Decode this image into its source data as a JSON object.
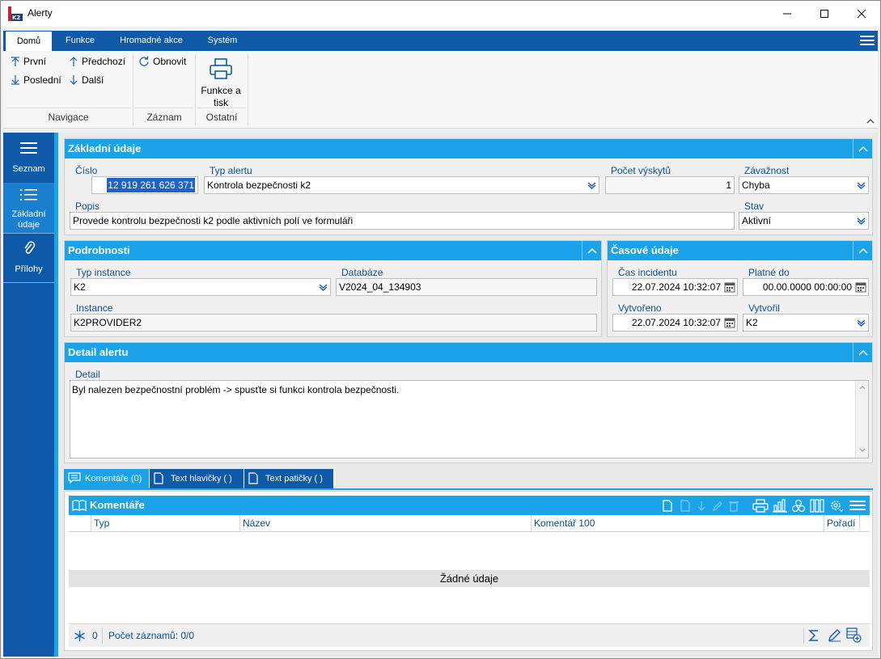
{
  "window": {
    "title": "Alerty",
    "app_icon": "k2-logo-icon",
    "controls": [
      "minimize-icon",
      "maximize-icon",
      "close-icon"
    ]
  },
  "ribbon": {
    "tabs": [
      {
        "label": "Domů",
        "active": true
      },
      {
        "label": "Funkce"
      },
      {
        "label": "Hromadné akce"
      },
      {
        "label": "Systém"
      }
    ],
    "groups": {
      "navigace": {
        "label": "Navigace",
        "first": "První",
        "previous": "Předchozí",
        "last": "Poslední",
        "next": "Další"
      },
      "zaznam": {
        "label": "Záznam",
        "refresh": "Obnovit"
      },
      "ostatni": {
        "label": "Ostatní",
        "print_line1": "Funkce a",
        "print_line2": "tisk"
      }
    }
  },
  "leftnav": {
    "items": [
      {
        "label": "Seznam",
        "icon": "menu-icon"
      },
      {
        "label_line1": "Základní",
        "label_line2": "údaje",
        "icon": "list-icon",
        "active": true
      },
      {
        "label": "Přílohy",
        "icon": "paperclip-icon"
      }
    ]
  },
  "zakladni": {
    "header": "Základní údaje",
    "cislo_label": "Číslo",
    "cislo": "12 919 261 626 371",
    "typ_label": "Typ alertu",
    "typ": "Kontrola bezpečnosti k2",
    "pocet_label": "Počet výskytů",
    "pocet": "1",
    "zavaznost_label": "Závažnost",
    "zavaznost": "Chyba",
    "popis_label": "Popis",
    "popis": "Provede kontrolu bezpečnosti k2 podle aktivních polí ve formuláři",
    "stav_label": "Stav",
    "stav": "Aktivní"
  },
  "podrobnosti": {
    "header": "Podrobnosti",
    "typ_instance_label": "Typ instance",
    "typ_instance": "K2",
    "databaze_label": "Databáze",
    "databaze": "V2024_04_134903",
    "instance_label": "Instance",
    "instance": "K2PROVIDER2"
  },
  "casove": {
    "header": "Časové údaje",
    "cas_label": "Čas incidentu",
    "cas": "22.07.2024 10:32:07",
    "platne_label": "Platné do",
    "platne": "00.00.0000 00:00:00",
    "vytvoreno_label": "Vytvořeno",
    "vytvoreno": "22.07.2024 10:32:07",
    "vytvoril_label": "Vytvořil",
    "vytvoril": "K2"
  },
  "detail": {
    "header": "Detail alertu",
    "label": "Detail",
    "text": "Byl nalezen bezpečnostní problém -> spusťte si funkci kontrola bezpečnosti."
  },
  "bottom_tabs": [
    {
      "label": "Komentáře (0)",
      "icon": "comment-icon",
      "active": true
    },
    {
      "label": "Text hlavičky ( )",
      "icon": "document-icon"
    },
    {
      "label": "Text patičky ( )",
      "icon": "document-icon"
    }
  ],
  "komentare": {
    "header": "Komentáře",
    "columns": [
      "Typ",
      "Název",
      "Komentář 100",
      "Pořadí"
    ],
    "empty": "Žádné údaje",
    "footer_count": "0",
    "footer_records": "Počet záznamů: 0/0"
  }
}
